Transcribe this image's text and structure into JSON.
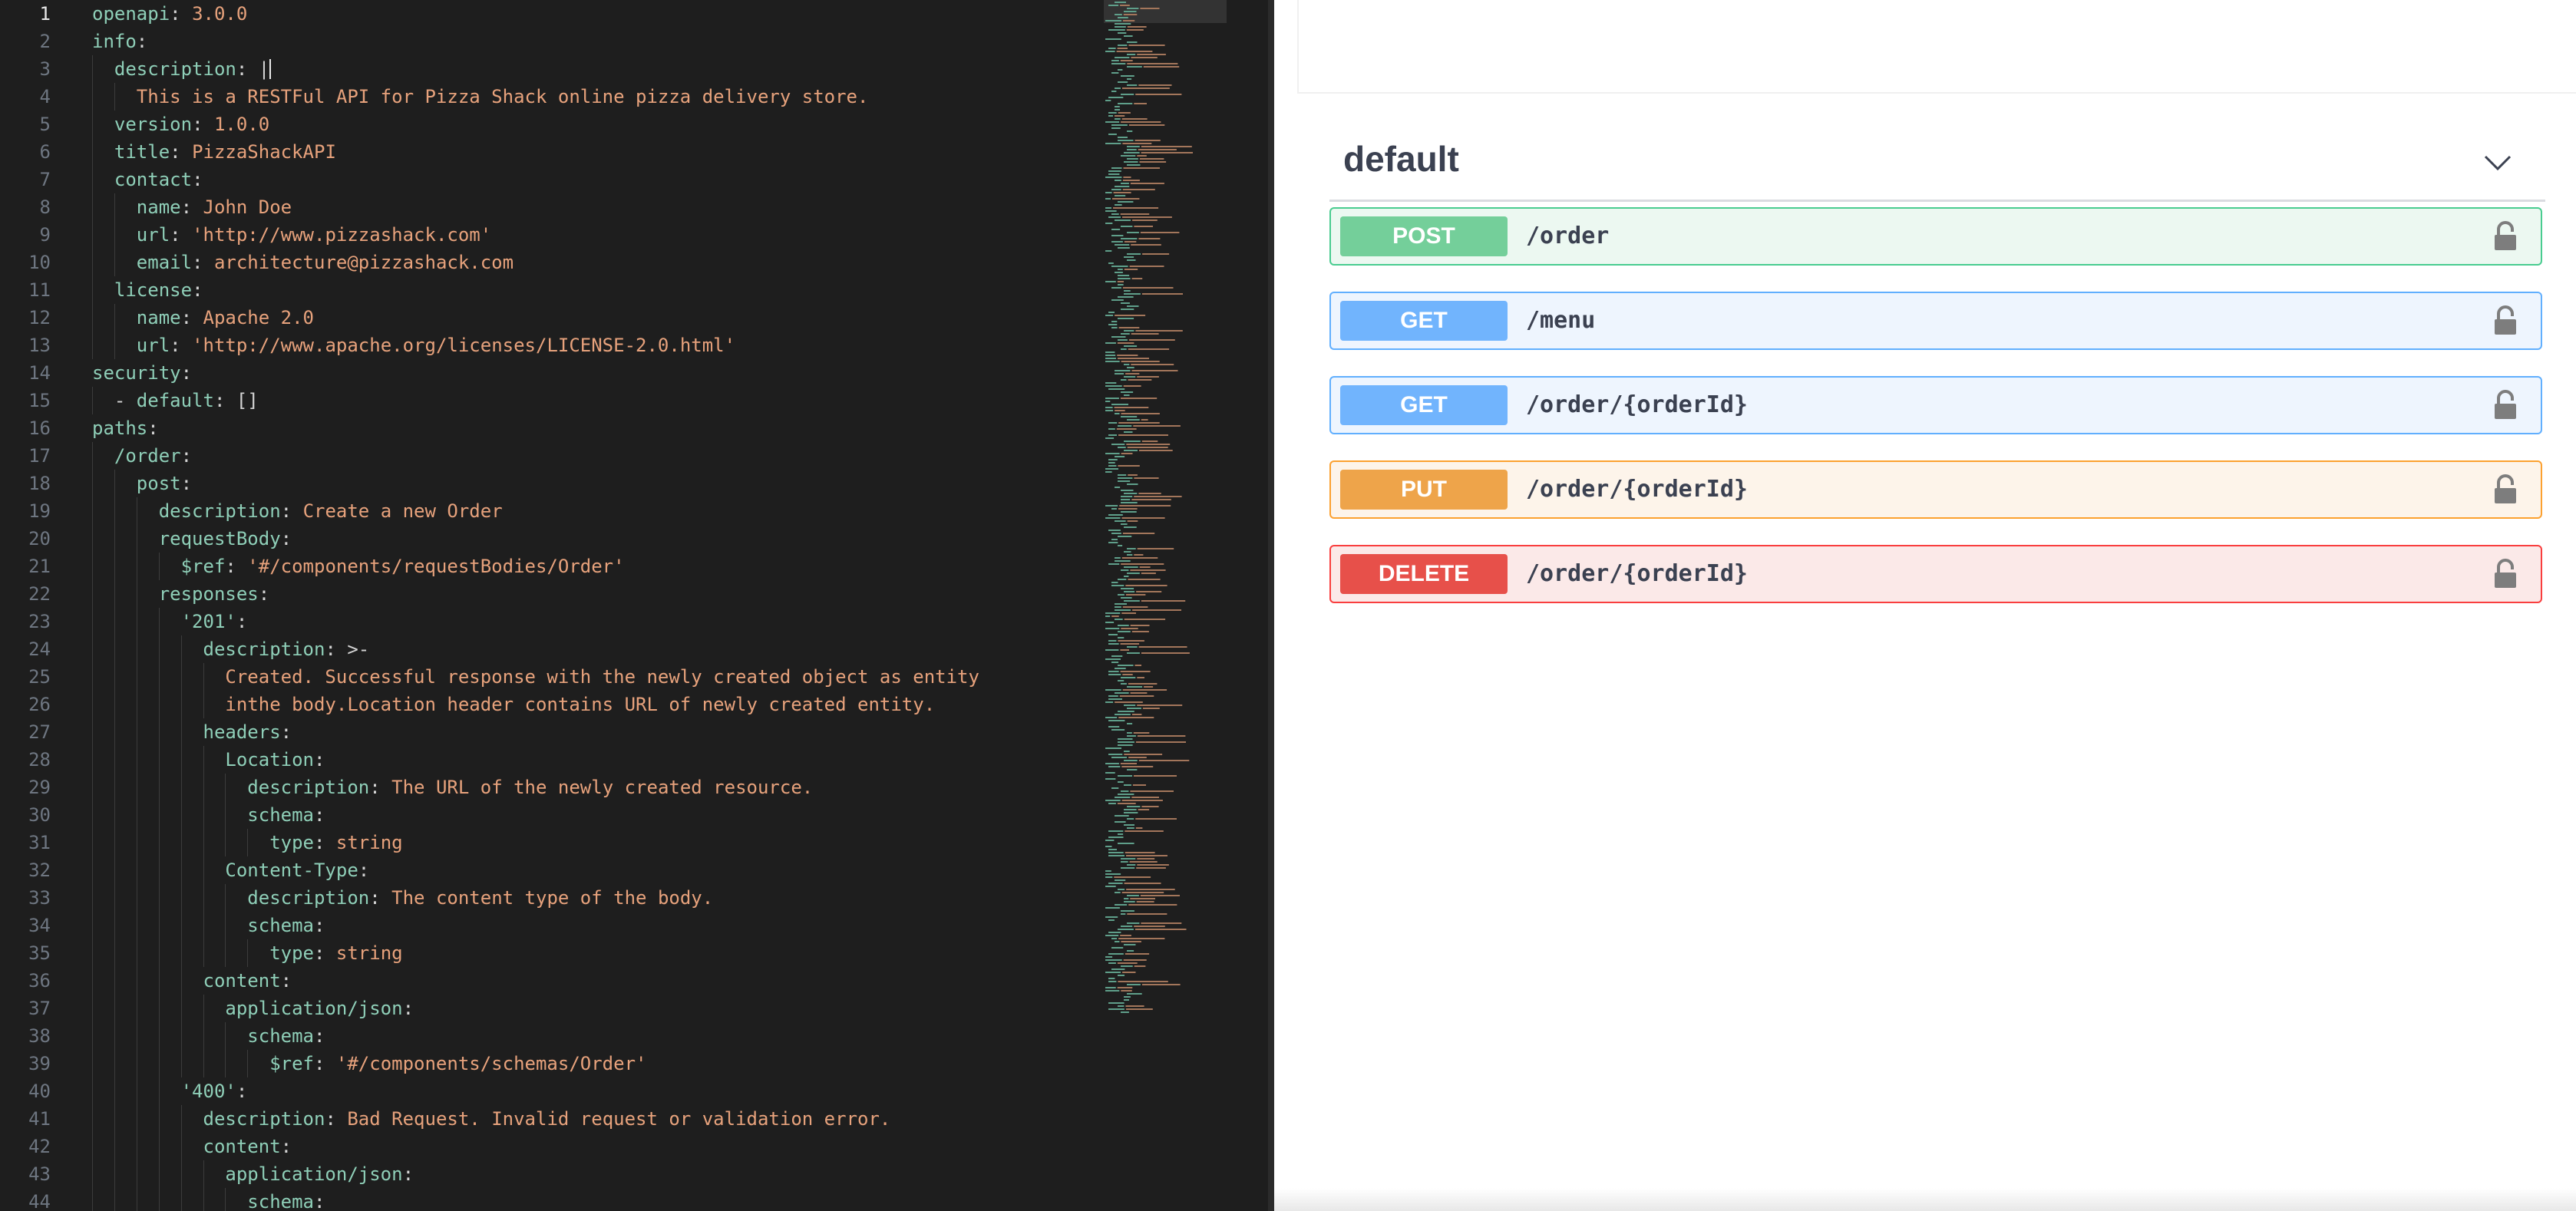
{
  "editor": {
    "line_numbers": [
      "1",
      "2",
      "3",
      "4",
      "5",
      "6",
      "7",
      "8",
      "9",
      "10",
      "11",
      "12",
      "13",
      "14",
      "15",
      "16",
      "17",
      "18",
      "19",
      "20",
      "21",
      "22",
      "23",
      "24",
      "25",
      "26",
      "27",
      "28",
      "29",
      "30",
      "31",
      "32",
      "33",
      "34",
      "35",
      "36",
      "37",
      "38",
      "39",
      "40",
      "41",
      "42",
      "43",
      "44"
    ],
    "lines": [
      [
        {
          "t": "k",
          "s": "openapi"
        },
        {
          "t": "p",
          "s": ": "
        },
        {
          "t": "v",
          "s": "3.0.0"
        }
      ],
      [
        {
          "t": "k",
          "s": "info"
        },
        {
          "t": "p",
          "s": ":"
        }
      ],
      [
        {
          "t": "p",
          "s": "  "
        },
        {
          "t": "k",
          "s": "description"
        },
        {
          "t": "p",
          "s": ": |"
        }
      ],
      [
        {
          "t": "p",
          "s": "    "
        },
        {
          "t": "v",
          "s": "This is a RESTFul API for Pizza Shack online pizza delivery store."
        }
      ],
      [
        {
          "t": "p",
          "s": "  "
        },
        {
          "t": "k",
          "s": "version"
        },
        {
          "t": "p",
          "s": ": "
        },
        {
          "t": "v",
          "s": "1.0.0"
        }
      ],
      [
        {
          "t": "p",
          "s": "  "
        },
        {
          "t": "k",
          "s": "title"
        },
        {
          "t": "p",
          "s": ": "
        },
        {
          "t": "v",
          "s": "PizzaShackAPI"
        }
      ],
      [
        {
          "t": "p",
          "s": "  "
        },
        {
          "t": "k",
          "s": "contact"
        },
        {
          "t": "p",
          "s": ":"
        }
      ],
      [
        {
          "t": "p",
          "s": "    "
        },
        {
          "t": "k",
          "s": "name"
        },
        {
          "t": "p",
          "s": ": "
        },
        {
          "t": "v",
          "s": "John Doe"
        }
      ],
      [
        {
          "t": "p",
          "s": "    "
        },
        {
          "t": "k",
          "s": "url"
        },
        {
          "t": "p",
          "s": ": "
        },
        {
          "t": "v",
          "s": "'http://www.pizzashack.com'"
        }
      ],
      [
        {
          "t": "p",
          "s": "    "
        },
        {
          "t": "k",
          "s": "email"
        },
        {
          "t": "p",
          "s": ": "
        },
        {
          "t": "v",
          "s": "architecture@pizzashack.com"
        }
      ],
      [
        {
          "t": "p",
          "s": "  "
        },
        {
          "t": "k",
          "s": "license"
        },
        {
          "t": "p",
          "s": ":"
        }
      ],
      [
        {
          "t": "p",
          "s": "    "
        },
        {
          "t": "k",
          "s": "name"
        },
        {
          "t": "p",
          "s": ": "
        },
        {
          "t": "v",
          "s": "Apache 2.0"
        }
      ],
      [
        {
          "t": "p",
          "s": "    "
        },
        {
          "t": "k",
          "s": "url"
        },
        {
          "t": "p",
          "s": ": "
        },
        {
          "t": "v",
          "s": "'http://www.apache.org/licenses/LICENSE-2.0.html'"
        }
      ],
      [
        {
          "t": "k",
          "s": "security"
        },
        {
          "t": "p",
          "s": ":"
        }
      ],
      [
        {
          "t": "p",
          "s": "  - "
        },
        {
          "t": "k",
          "s": "default"
        },
        {
          "t": "p",
          "s": ": []"
        }
      ],
      [
        {
          "t": "k",
          "s": "paths"
        },
        {
          "t": "p",
          "s": ":"
        }
      ],
      [
        {
          "t": "p",
          "s": "  "
        },
        {
          "t": "k",
          "s": "/order"
        },
        {
          "t": "p",
          "s": ":"
        }
      ],
      [
        {
          "t": "p",
          "s": "    "
        },
        {
          "t": "k",
          "s": "post"
        },
        {
          "t": "p",
          "s": ":"
        }
      ],
      [
        {
          "t": "p",
          "s": "      "
        },
        {
          "t": "k",
          "s": "description"
        },
        {
          "t": "p",
          "s": ": "
        },
        {
          "t": "v",
          "s": "Create a new Order"
        }
      ],
      [
        {
          "t": "p",
          "s": "      "
        },
        {
          "t": "k",
          "s": "requestBody"
        },
        {
          "t": "p",
          "s": ":"
        }
      ],
      [
        {
          "t": "p",
          "s": "        "
        },
        {
          "t": "k",
          "s": "$ref"
        },
        {
          "t": "p",
          "s": ": "
        },
        {
          "t": "v",
          "s": "'#/components/requestBodies/Order'"
        }
      ],
      [
        {
          "t": "p",
          "s": "      "
        },
        {
          "t": "k",
          "s": "responses"
        },
        {
          "t": "p",
          "s": ":"
        }
      ],
      [
        {
          "t": "p",
          "s": "        "
        },
        {
          "t": "k",
          "s": "'201'"
        },
        {
          "t": "p",
          "s": ":"
        }
      ],
      [
        {
          "t": "p",
          "s": "          "
        },
        {
          "t": "k",
          "s": "description"
        },
        {
          "t": "p",
          "s": ": >-"
        }
      ],
      [
        {
          "t": "p",
          "s": "            "
        },
        {
          "t": "v",
          "s": "Created. Successful response with the newly created object as entity"
        }
      ],
      [
        {
          "t": "p",
          "s": "            "
        },
        {
          "t": "v",
          "s": "inthe body.Location header contains URL of newly created entity."
        }
      ],
      [
        {
          "t": "p",
          "s": "          "
        },
        {
          "t": "k",
          "s": "headers"
        },
        {
          "t": "p",
          "s": ":"
        }
      ],
      [
        {
          "t": "p",
          "s": "            "
        },
        {
          "t": "k",
          "s": "Location"
        },
        {
          "t": "p",
          "s": ":"
        }
      ],
      [
        {
          "t": "p",
          "s": "              "
        },
        {
          "t": "k",
          "s": "description"
        },
        {
          "t": "p",
          "s": ": "
        },
        {
          "t": "v",
          "s": "The URL of the newly created resource."
        }
      ],
      [
        {
          "t": "p",
          "s": "              "
        },
        {
          "t": "k",
          "s": "schema"
        },
        {
          "t": "p",
          "s": ":"
        }
      ],
      [
        {
          "t": "p",
          "s": "                "
        },
        {
          "t": "k",
          "s": "type"
        },
        {
          "t": "p",
          "s": ": "
        },
        {
          "t": "v",
          "s": "string"
        }
      ],
      [
        {
          "t": "p",
          "s": "            "
        },
        {
          "t": "k",
          "s": "Content-Type"
        },
        {
          "t": "p",
          "s": ":"
        }
      ],
      [
        {
          "t": "p",
          "s": "              "
        },
        {
          "t": "k",
          "s": "description"
        },
        {
          "t": "p",
          "s": ": "
        },
        {
          "t": "v",
          "s": "The content type of the body."
        }
      ],
      [
        {
          "t": "p",
          "s": "              "
        },
        {
          "t": "k",
          "s": "schema"
        },
        {
          "t": "p",
          "s": ":"
        }
      ],
      [
        {
          "t": "p",
          "s": "                "
        },
        {
          "t": "k",
          "s": "type"
        },
        {
          "t": "p",
          "s": ": "
        },
        {
          "t": "v",
          "s": "string"
        }
      ],
      [
        {
          "t": "p",
          "s": "          "
        },
        {
          "t": "k",
          "s": "content"
        },
        {
          "t": "p",
          "s": ":"
        }
      ],
      [
        {
          "t": "p",
          "s": "            "
        },
        {
          "t": "k",
          "s": "application/json"
        },
        {
          "t": "p",
          "s": ":"
        }
      ],
      [
        {
          "t": "p",
          "s": "              "
        },
        {
          "t": "k",
          "s": "schema"
        },
        {
          "t": "p",
          "s": ":"
        }
      ],
      [
        {
          "t": "p",
          "s": "                "
        },
        {
          "t": "k",
          "s": "$ref"
        },
        {
          "t": "p",
          "s": ": "
        },
        {
          "t": "v",
          "s": "'#/components/schemas/Order'"
        }
      ],
      [
        {
          "t": "p",
          "s": "        "
        },
        {
          "t": "k",
          "s": "'400'"
        },
        {
          "t": "p",
          "s": ":"
        }
      ],
      [
        {
          "t": "p",
          "s": "          "
        },
        {
          "t": "k",
          "s": "description"
        },
        {
          "t": "p",
          "s": ": "
        },
        {
          "t": "v",
          "s": "Bad Request. Invalid request or validation error."
        }
      ],
      [
        {
          "t": "p",
          "s": "          "
        },
        {
          "t": "k",
          "s": "content"
        },
        {
          "t": "p",
          "s": ":"
        }
      ],
      [
        {
          "t": "p",
          "s": "            "
        },
        {
          "t": "k",
          "s": "application/json"
        },
        {
          "t": "p",
          "s": ":"
        }
      ],
      [
        {
          "t": "p",
          "s": "              "
        },
        {
          "t": "k",
          "s": "schema"
        },
        {
          "t": "p",
          "s": ":"
        }
      ]
    ]
  },
  "swagger": {
    "tag": {
      "name": "default",
      "toggle_icon": "chevron-down-icon"
    },
    "operations": [
      {
        "method": "POST",
        "path": "/order",
        "color": "#49cc90",
        "badge": "#74cf9a",
        "bg": "#ecf8f1"
      },
      {
        "method": "GET",
        "path": "/menu",
        "color": "#61affe",
        "badge": "#71b4fd",
        "bg": "#eef5fe"
      },
      {
        "method": "GET",
        "path": "/order/{orderId}",
        "color": "#61affe",
        "badge": "#71b4fd",
        "bg": "#eef5fe"
      },
      {
        "method": "PUT",
        "path": "/order/{orderId}",
        "color": "#fca130",
        "badge": "#eea44a",
        "bg": "#fdf4ea"
      },
      {
        "method": "DELETE",
        "path": "/order/{orderId}",
        "color": "#f93e3e",
        "badge": "#e7504a",
        "bg": "#fbe9e8"
      }
    ],
    "lock_icon": "lock-icon"
  },
  "colors": {
    "editor_bg": "#1e1e1e",
    "key": "#8fcfb8",
    "value": "#e7a27c",
    "text": "#3b4151"
  }
}
